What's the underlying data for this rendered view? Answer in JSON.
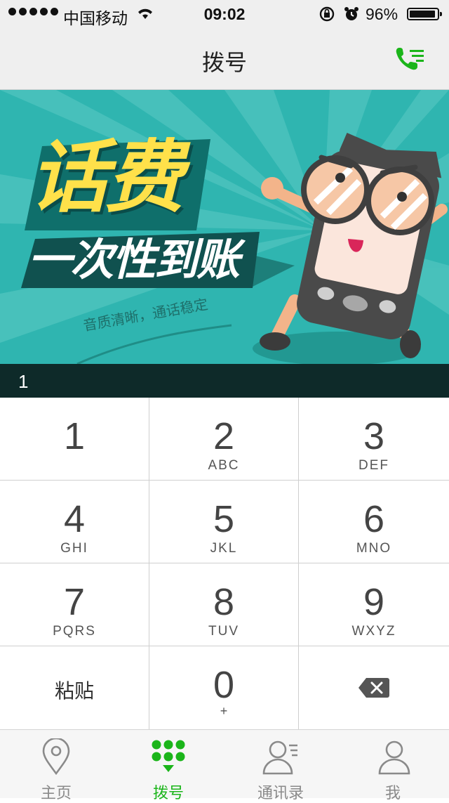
{
  "status_bar": {
    "carrier": "中国移动",
    "time": "09:02",
    "battery_percent": "96%",
    "battery_level": 0.96
  },
  "nav": {
    "title": "拨号",
    "right_icon": "call-list-icon"
  },
  "banner": {
    "headline": "话费",
    "subheadline": "一次性到账",
    "tagline": "音质清晰，通话稳定"
  },
  "display": {
    "number": "1"
  },
  "keypad": {
    "keys": [
      {
        "digit": "1",
        "letters": ""
      },
      {
        "digit": "2",
        "letters": "ABC"
      },
      {
        "digit": "3",
        "letters": "DEF"
      },
      {
        "digit": "4",
        "letters": "GHI"
      },
      {
        "digit": "5",
        "letters": "JKL"
      },
      {
        "digit": "6",
        "letters": "MNO"
      },
      {
        "digit": "7",
        "letters": "PQRS"
      },
      {
        "digit": "8",
        "letters": "TUV"
      },
      {
        "digit": "9",
        "letters": "WXYZ"
      }
    ],
    "paste_label": "粘贴",
    "zero_digit": "0",
    "zero_sub": "+",
    "delete_icon": "backspace-icon"
  },
  "tabbar": {
    "tabs": [
      {
        "label": "主页",
        "icon": "location-pin-icon"
      },
      {
        "label": "拨号",
        "icon": "dialpad-icon",
        "active": true
      },
      {
        "label": "通讯录",
        "icon": "contacts-icon"
      },
      {
        "label": "我",
        "icon": "person-icon"
      }
    ]
  },
  "colors": {
    "accent_green": "#1bb51a",
    "banner_teal": "#2fb5b0",
    "display_bg": "#0e2a29",
    "headline_yellow": "#ffe14a"
  }
}
